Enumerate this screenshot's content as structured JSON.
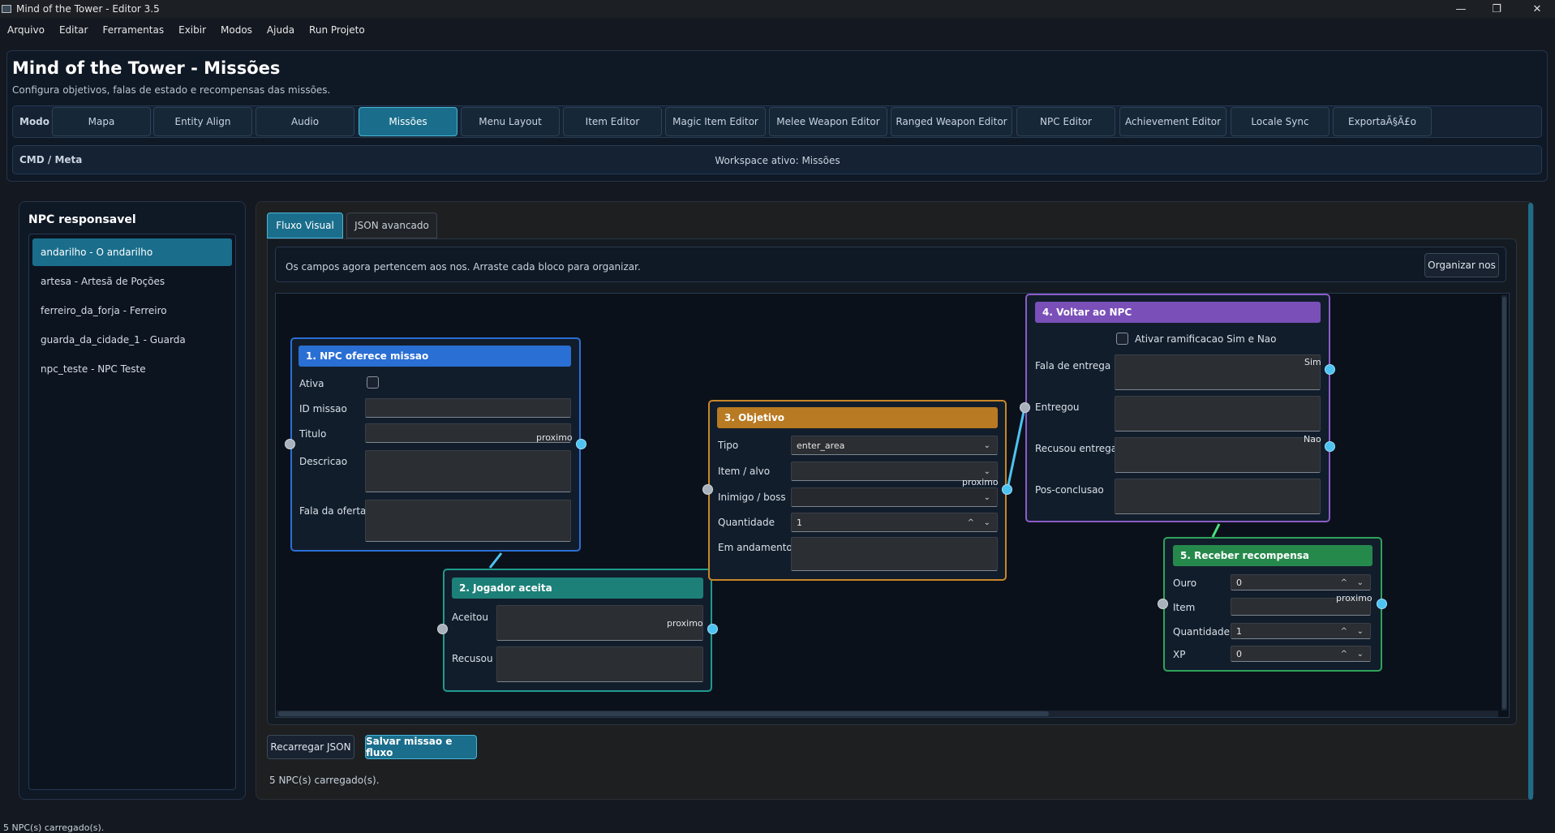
{
  "window": {
    "title": "Mind of the Tower - Editor 3.5",
    "controls": [
      "—",
      "❐",
      "✕"
    ]
  },
  "menu": [
    "Arquivo",
    "Editar",
    "Ferramentas",
    "Exibir",
    "Modos",
    "Ajuda",
    "Run Projeto"
  ],
  "header": {
    "title": "Mind of the Tower - Missões",
    "subtitle": "Configura objetivos, falas de estado e recompensas das missões.",
    "mode_label": "Modo",
    "modes": [
      "Mapa",
      "Entity Align",
      "Audio",
      "Missões",
      "Menu Layout",
      "Item Editor",
      "Magic Item Editor",
      "Melee Weapon Editor",
      "Ranged Weapon Editor",
      "NPC Editor",
      "Achievement Editor",
      "Locale Sync",
      "ExportaÃ§Ã£o"
    ],
    "active_mode": "Missões",
    "cmd_label": "CMD / Meta",
    "workspace": "Workspace ativo: Missões"
  },
  "npc_panel": {
    "title": "NPC responsavel",
    "items": [
      "andarilho - O andarilho",
      "artesa - Artesã de Poções",
      "ferreiro_da_forja - Ferreiro",
      "guarda_da_cidade_1 - Guarda",
      "npc_teste - NPC Teste"
    ],
    "selected": "andarilho - O andarilho"
  },
  "tabs": [
    "Fluxo Visual",
    "JSON avancado"
  ],
  "active_tab": "Fluxo Visual",
  "info": {
    "text": "Os campos agora pertencem aos nos. Arraste cada bloco para organizar.",
    "organize_button": "Organizar nos"
  },
  "nodes": {
    "n1": {
      "title": "1. NPC oferece missao",
      "labels": [
        "Ativa",
        "ID missao",
        "Titulo",
        "Descricao",
        "Fala da oferta"
      ],
      "out_label": "proximo"
    },
    "n2": {
      "title": "2. Jogador aceita",
      "labels": [
        "Aceitou",
        "Recusou"
      ],
      "out_label": "proximo"
    },
    "n3": {
      "title": "3. Objetivo",
      "labels": [
        "Tipo",
        "Item / alvo",
        "Inimigo / boss",
        "Quantidade",
        "Em andamento"
      ],
      "tipo_value": "enter_area",
      "quantidade_value": "1",
      "out_label": "proximo"
    },
    "n4": {
      "title": "4. Voltar ao NPC",
      "checkbox_label": "Ativar ramificacao Sim e Nao",
      "labels": [
        "Fala de entrega",
        "Entregou",
        "Recusou entrega",
        "Pos-conclusao"
      ],
      "out_yes": "Sim",
      "out_no": "Nao"
    },
    "n5": {
      "title": "5. Receber recompensa",
      "labels": [
        "Ouro",
        "Item",
        "Quantidade",
        "XP"
      ],
      "ouro_value": "0",
      "quantidade_value": "1",
      "xp_value": "0",
      "out_label": "proximo"
    }
  },
  "buttons": {
    "reload": "Recarregar JSON",
    "save": "Salvar missao e fluxo"
  },
  "status": {
    "inner": "5 NPC(s) carregado(s).",
    "outer": "5 NPC(s) carregado(s)."
  },
  "colors": {
    "accent": "#1a6e8c",
    "n1": "#2a6fd4",
    "n2": "#1e9b8e",
    "n3": "#d4882a",
    "n4": "#8a5cc8",
    "n5": "#2ea35a",
    "port_out": "#4cc3f0"
  },
  "icons": [
    "chevron-down-icon",
    "chevron-up-icon",
    "checkbox-icon",
    "minimize-icon",
    "maximize-icon",
    "close-icon"
  ]
}
